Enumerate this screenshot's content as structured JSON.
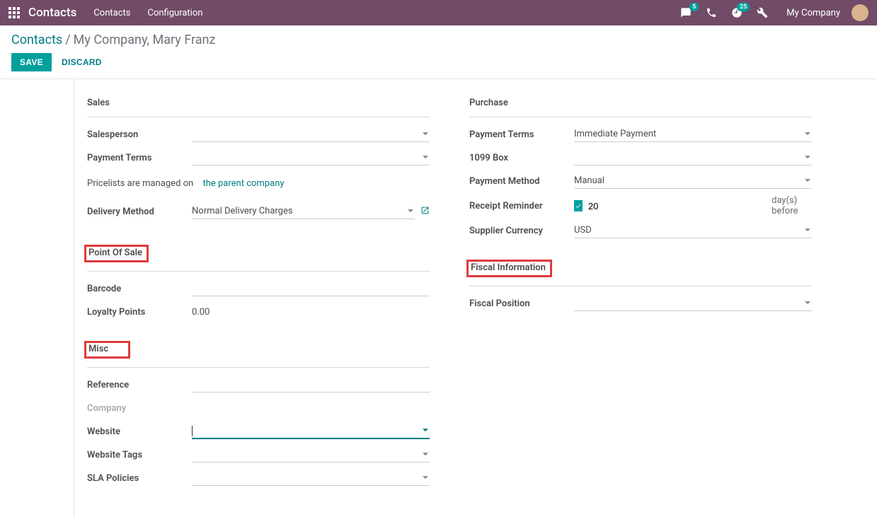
{
  "topnav": {
    "brand": "Contacts",
    "links": [
      "Contacts",
      "Configuration"
    ],
    "chat_badge": "5",
    "activity_badge": "25",
    "company": "My Company"
  },
  "breadcrumb": {
    "root": "Contacts",
    "leaf": "My Company, Mary Franz"
  },
  "actions": {
    "save": "SAVE",
    "discard": "DISCARD"
  },
  "left": {
    "sales": {
      "title": "Sales",
      "salesperson_label": "Salesperson",
      "salesperson_value": "",
      "payment_terms_label": "Payment Terms",
      "payment_terms_value": "",
      "pricelist_note_prefix": "Pricelists are managed on",
      "pricelist_note_link": "the parent company",
      "delivery_label": "Delivery Method",
      "delivery_value": "Normal Delivery Charges"
    },
    "pos": {
      "title": "Point Of Sale",
      "barcode_label": "Barcode",
      "barcode_value": "",
      "loyalty_label": "Loyalty Points",
      "loyalty_value": "0.00"
    },
    "misc": {
      "title": "Misc",
      "reference_label": "Reference",
      "reference_value": "",
      "company_label": "Company",
      "website_label": "Website",
      "website_value": "",
      "website_tags_label": "Website Tags",
      "website_tags_value": "",
      "sla_label": "SLA Policies",
      "sla_value": ""
    }
  },
  "right": {
    "purchase": {
      "title": "Purchase",
      "payment_terms_label": "Payment Terms",
      "payment_terms_value": "Immediate Payment",
      "box1099_label": "1099 Box",
      "box1099_value": "",
      "payment_method_label": "Payment Method",
      "payment_method_value": "Manual",
      "reminder_label": "Receipt Reminder",
      "reminder_checked": true,
      "reminder_value": "20",
      "reminder_suffix": "day(s) before",
      "currency_label": "Supplier Currency",
      "currency_value": "USD"
    },
    "fiscal": {
      "title": "Fiscal Information",
      "position_label": "Fiscal Position",
      "position_value": ""
    }
  }
}
